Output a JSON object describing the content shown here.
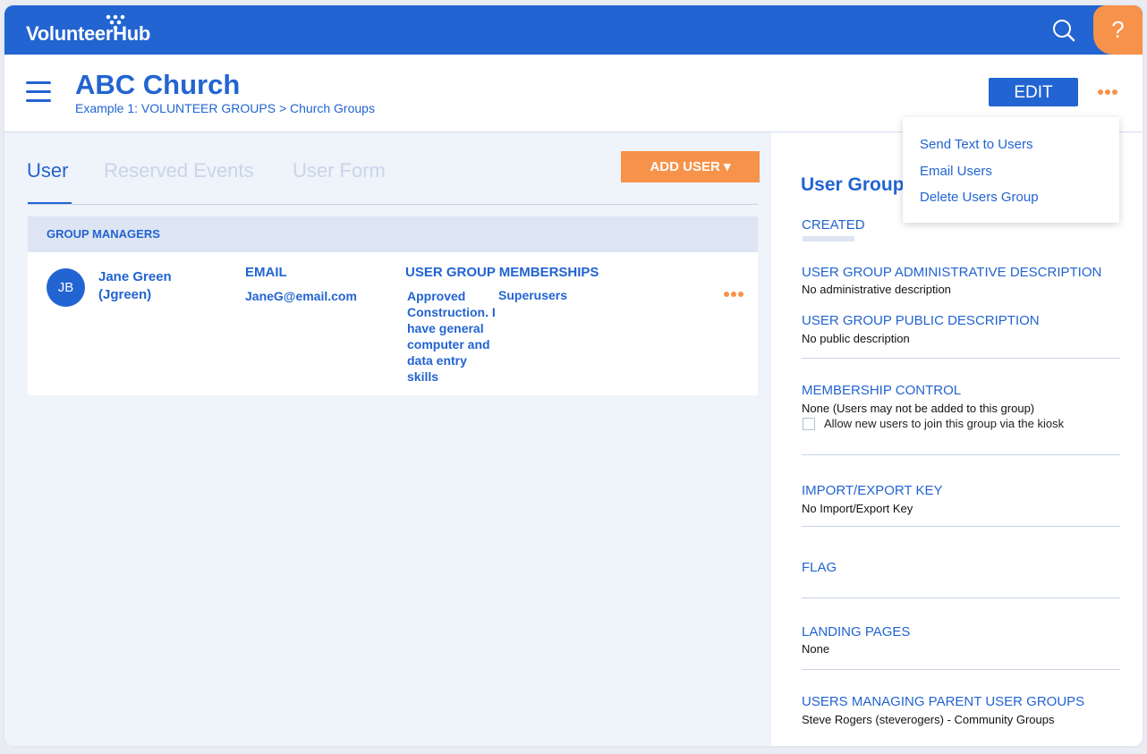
{
  "app": {
    "brand": "VolunteerHub",
    "help_glyph": "?",
    "search_icon": "search-icon"
  },
  "header": {
    "title": "ABC Church",
    "breadcrumb": "Example 1: VOLUNTEER GROUPS > Church Groups",
    "edit_label": "EDIT"
  },
  "tabs": [
    {
      "label": "User",
      "active": true
    },
    {
      "label": "Reserved Events",
      "active": false
    },
    {
      "label": "User Form",
      "active": false
    }
  ],
  "add_user_label": "ADD USER ▾",
  "group_managers": {
    "section_label": "GROUP MANAGERS",
    "columns": {
      "email": "EMAIL",
      "memberships": "USER GROUP MEMBERSHIPS"
    },
    "rows": [
      {
        "initials": "JB",
        "name": "Jane Green (Jgreen)",
        "email": "JaneG@email.com",
        "membership_1": "Approved Construction. I have general computer and data entry skills",
        "membership_2": "Superusers"
      }
    ]
  },
  "dropdown": {
    "items": [
      "Send Text to Users",
      "Email Users",
      "Delete Users Group"
    ]
  },
  "details": {
    "title": "User Group",
    "created_label": "CREATED",
    "admin_desc_label": "USER GROUP ADMINISTRATIVE DESCRIPTION",
    "admin_desc_value": "No administrative description",
    "public_desc_label": "USER GROUP PUBLIC DESCRIPTION",
    "public_desc_value": "No public description",
    "membership_label": "MEMBERSHIP CONTROL",
    "membership_value": "None (Users may not be added to this group)",
    "kiosk_label": "Allow new users to join this group via the kiosk",
    "kiosk_checked": false,
    "import_label": "IMPORT/EXPORT KEY",
    "import_value": "No Import/Export Key",
    "flag_label": "FLAG",
    "landing_label": "LANDING PAGES",
    "landing_value": "None",
    "parent_label": "USERS MANAGING PARENT USER GROUPS",
    "parent_value": "Steve Rogers (steverogers) - Community Groups"
  },
  "colors": {
    "primary": "#2264d1",
    "accent": "#f7924a",
    "panel_bg": "#eff3fa"
  }
}
